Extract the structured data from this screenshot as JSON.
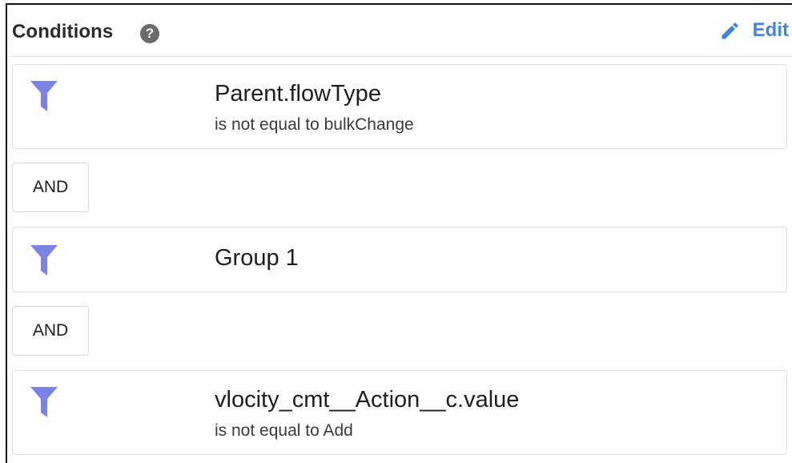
{
  "header": {
    "title": "Conditions",
    "help_icon": "?",
    "edit_label": "Edit",
    "accent_color": "#3f86d8"
  },
  "conditions": [
    {
      "title": "Parent.flowType",
      "subtitle": "is not equal to bulkChange",
      "icon": "filter-icon"
    },
    {
      "title": "Group 1",
      "subtitle": "",
      "icon": "filter-icon"
    },
    {
      "title": "vlocity_cmt__Action__c.value",
      "subtitle": "is not equal to Add",
      "icon": "filter-icon"
    }
  ],
  "operators": [
    "AND",
    "AND"
  ],
  "icon_color": "#7b84e6"
}
